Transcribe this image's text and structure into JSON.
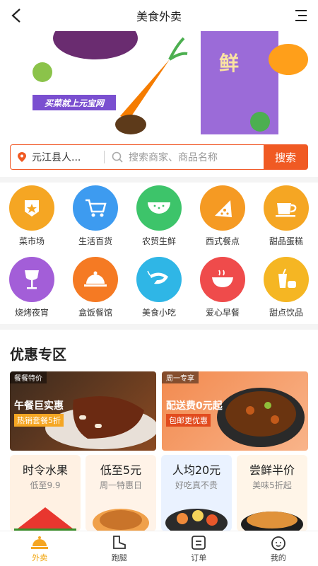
{
  "header": {
    "title": "美食外卖"
  },
  "banner": {
    "promo_text": "买菜就上元宝网",
    "fresh_char": "鲜"
  },
  "search": {
    "location": "元江县人...",
    "placeholder": "搜索商家、商品名称",
    "button": "搜索"
  },
  "categories": [
    {
      "label": "菜市场",
      "icon": "market-icon",
      "color": "#f5a623"
    },
    {
      "label": "生活百货",
      "icon": "cart-icon",
      "color": "#3d9bf0"
    },
    {
      "label": "农贸生鲜",
      "icon": "watermelon-icon",
      "color": "#3dc46a"
    },
    {
      "label": "西式餐点",
      "icon": "pizza-icon",
      "color": "#f59a23"
    },
    {
      "label": "甜品蛋糕",
      "icon": "coffee-icon",
      "color": "#f5a623"
    },
    {
      "label": "烧烤夜宵",
      "icon": "wine-icon",
      "color": "#a35ed8"
    },
    {
      "label": "盒饭餐馆",
      "icon": "dish-cover-icon",
      "color": "#f57a23"
    },
    {
      "label": "美食小吃",
      "icon": "shrimp-icon",
      "color": "#2fb6e6"
    },
    {
      "label": "爱心早餐",
      "icon": "bowl-icon",
      "color": "#ef4b4b"
    },
    {
      "label": "甜点饮品",
      "icon": "drink-icon",
      "color": "#f5b623"
    }
  ],
  "promo": {
    "title": "优惠专区",
    "deal1": {
      "tag": "餐餐特价",
      "big": "午餐巨实惠",
      "sub": "热销套餐5折"
    },
    "deal2": {
      "tag": "周一专享",
      "big": "配送费0元起",
      "sub": "包邮更优惠"
    },
    "smalls": [
      {
        "t": "时令水果",
        "s": "低至9.9"
      },
      {
        "t": "低至5元",
        "s": "周一特惠日"
      },
      {
        "t": "人均20元",
        "s": "好吃真不贵"
      },
      {
        "t": "尝鲜半价",
        "s": "美味5折起"
      }
    ]
  },
  "tabs": [
    {
      "label": "外卖",
      "icon": "takeout-icon"
    },
    {
      "label": "跑腿",
      "icon": "boot-icon"
    },
    {
      "label": "订单",
      "icon": "order-icon"
    },
    {
      "label": "我的",
      "icon": "profile-icon"
    }
  ]
}
